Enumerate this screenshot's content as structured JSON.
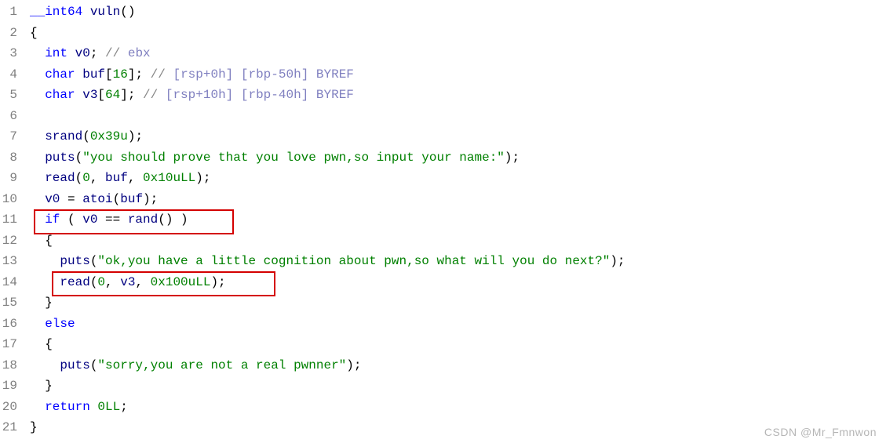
{
  "watermark": "CSDN @Mr_Fmnwon",
  "lines": [
    {
      "n": "1",
      "tokens": [
        {
          "t": "__int64 ",
          "c": "kw-blue"
        },
        {
          "t": "vuln",
          "c": "fn-navy"
        },
        {
          "t": "()",
          "c": "plain"
        }
      ]
    },
    {
      "n": "2",
      "tokens": [
        {
          "t": "{",
          "c": "plain"
        }
      ]
    },
    {
      "n": "3",
      "tokens": [
        {
          "t": "  ",
          "c": "plain"
        },
        {
          "t": "int",
          "c": "kw-blue"
        },
        {
          "t": " ",
          "c": "plain"
        },
        {
          "t": "v0",
          "c": "var-navy"
        },
        {
          "t": "; ",
          "c": "plain"
        },
        {
          "t": "//",
          "c": "cmt-gray"
        },
        {
          "t": " ebx",
          "c": "cmt-purple"
        }
      ]
    },
    {
      "n": "4",
      "tokens": [
        {
          "t": "  ",
          "c": "plain"
        },
        {
          "t": "char",
          "c": "kw-blue"
        },
        {
          "t": " ",
          "c": "plain"
        },
        {
          "t": "buf",
          "c": "var-navy"
        },
        {
          "t": "[",
          "c": "plain"
        },
        {
          "t": "16",
          "c": "num-green"
        },
        {
          "t": "]; ",
          "c": "plain"
        },
        {
          "t": "//",
          "c": "cmt-gray"
        },
        {
          "t": " [rsp+0h] [rbp-50h] BYREF",
          "c": "cmt-purple"
        }
      ]
    },
    {
      "n": "5",
      "tokens": [
        {
          "t": "  ",
          "c": "plain"
        },
        {
          "t": "char",
          "c": "kw-blue"
        },
        {
          "t": " ",
          "c": "plain"
        },
        {
          "t": "v3",
          "c": "var-navy"
        },
        {
          "t": "[",
          "c": "plain"
        },
        {
          "t": "64",
          "c": "num-green"
        },
        {
          "t": "]; ",
          "c": "plain"
        },
        {
          "t": "//",
          "c": "cmt-gray"
        },
        {
          "t": " [rsp+10h] [rbp-40h] BYREF",
          "c": "cmt-purple"
        }
      ]
    },
    {
      "n": "6",
      "tokens": []
    },
    {
      "n": "7",
      "tokens": [
        {
          "t": "  ",
          "c": "plain"
        },
        {
          "t": "srand",
          "c": "fn-navy"
        },
        {
          "t": "(",
          "c": "plain"
        },
        {
          "t": "0x39u",
          "c": "num-green"
        },
        {
          "t": ");",
          "c": "plain"
        }
      ]
    },
    {
      "n": "8",
      "tokens": [
        {
          "t": "  ",
          "c": "plain"
        },
        {
          "t": "puts",
          "c": "fn-navy"
        },
        {
          "t": "(",
          "c": "plain"
        },
        {
          "t": "\"you should prove that you love pwn,so input your name:\"",
          "c": "str-green"
        },
        {
          "t": ");",
          "c": "plain"
        }
      ]
    },
    {
      "n": "9",
      "tokens": [
        {
          "t": "  ",
          "c": "plain"
        },
        {
          "t": "read",
          "c": "fn-navy"
        },
        {
          "t": "(",
          "c": "plain"
        },
        {
          "t": "0",
          "c": "num-green"
        },
        {
          "t": ", ",
          "c": "plain"
        },
        {
          "t": "buf",
          "c": "var-navy"
        },
        {
          "t": ", ",
          "c": "plain"
        },
        {
          "t": "0x10uLL",
          "c": "num-green"
        },
        {
          "t": ");",
          "c": "plain"
        }
      ]
    },
    {
      "n": "10",
      "tokens": [
        {
          "t": "  ",
          "c": "plain"
        },
        {
          "t": "v0",
          "c": "var-navy"
        },
        {
          "t": " = ",
          "c": "plain"
        },
        {
          "t": "atoi",
          "c": "fn-navy"
        },
        {
          "t": "(",
          "c": "plain"
        },
        {
          "t": "buf",
          "c": "var-navy"
        },
        {
          "t": ");",
          "c": "plain"
        }
      ]
    },
    {
      "n": "11",
      "tokens": [
        {
          "t": "  ",
          "c": "plain"
        },
        {
          "t": "if",
          "c": "kw-blue"
        },
        {
          "t": " ( ",
          "c": "plain"
        },
        {
          "t": "v0",
          "c": "var-navy"
        },
        {
          "t": " == ",
          "c": "plain"
        },
        {
          "t": "rand",
          "c": "fn-navy"
        },
        {
          "t": "() )",
          "c": "plain"
        }
      ]
    },
    {
      "n": "12",
      "tokens": [
        {
          "t": "  {",
          "c": "plain"
        }
      ]
    },
    {
      "n": "13",
      "tokens": [
        {
          "t": "    ",
          "c": "plain"
        },
        {
          "t": "puts",
          "c": "fn-navy"
        },
        {
          "t": "(",
          "c": "plain"
        },
        {
          "t": "\"ok,you have a little cognition about pwn,so what will you do next?\"",
          "c": "str-green"
        },
        {
          "t": ");",
          "c": "plain"
        }
      ]
    },
    {
      "n": "14",
      "tokens": [
        {
          "t": "    ",
          "c": "plain"
        },
        {
          "t": "read",
          "c": "fn-navy"
        },
        {
          "t": "(",
          "c": "plain"
        },
        {
          "t": "0",
          "c": "num-green"
        },
        {
          "t": ", ",
          "c": "plain"
        },
        {
          "t": "v3",
          "c": "var-navy"
        },
        {
          "t": ", ",
          "c": "plain"
        },
        {
          "t": "0x100uLL",
          "c": "num-green"
        },
        {
          "t": ");",
          "c": "plain"
        }
      ]
    },
    {
      "n": "15",
      "tokens": [
        {
          "t": "  }",
          "c": "plain"
        }
      ]
    },
    {
      "n": "16",
      "tokens": [
        {
          "t": "  ",
          "c": "plain"
        },
        {
          "t": "else",
          "c": "kw-blue"
        }
      ]
    },
    {
      "n": "17",
      "tokens": [
        {
          "t": "  {",
          "c": "plain"
        }
      ]
    },
    {
      "n": "18",
      "tokens": [
        {
          "t": "    ",
          "c": "plain"
        },
        {
          "t": "puts",
          "c": "fn-navy"
        },
        {
          "t": "(",
          "c": "plain"
        },
        {
          "t": "\"sorry,you are not a real pwnner\"",
          "c": "str-green"
        },
        {
          "t": ");",
          "c": "plain"
        }
      ]
    },
    {
      "n": "19",
      "tokens": [
        {
          "t": "  }",
          "c": "plain"
        }
      ]
    },
    {
      "n": "20",
      "tokens": [
        {
          "t": "  ",
          "c": "plain"
        },
        {
          "t": "return",
          "c": "kw-blue"
        },
        {
          "t": " ",
          "c": "plain"
        },
        {
          "t": "0LL",
          "c": "num-green"
        },
        {
          "t": ";",
          "c": "plain"
        }
      ]
    },
    {
      "n": "21",
      "tokens": [
        {
          "t": "}",
          "c": "plain"
        }
      ]
    }
  ]
}
